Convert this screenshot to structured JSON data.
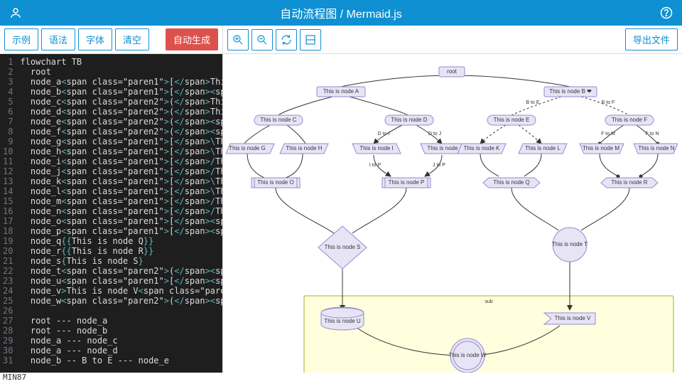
{
  "header": {
    "title": "自动流程图 / Mermaid.js"
  },
  "toolbar_left": {
    "example": "示例",
    "syntax": "语法",
    "font": "字体",
    "clear": "清空",
    "generate": "自动生成"
  },
  "toolbar_right": {
    "export": "导出文件"
  },
  "editor_lines": [
    {
      "n": 1,
      "raw": "flowchart TB"
    },
    {
      "n": 2,
      "raw": "  root"
    },
    {
      "n": 3,
      "raw": "  node_a[This is node A]"
    },
    {
      "n": 4,
      "raw": "  node_b[\"This is node B ❤ \"]",
      "str": true
    },
    {
      "n": 5,
      "raw": "  node_c(This is node C)"
    },
    {
      "n": 6,
      "raw": "  node_d(This is node D)"
    },
    {
      "n": 7,
      "raw": "  node_e([This is node E])"
    },
    {
      "n": 8,
      "raw": "  node_f([This is node F])"
    },
    {
      "n": 9,
      "raw": "  node_g[\\This is node G/]"
    },
    {
      "n": 10,
      "raw": "  node_h[\\This is node H/]"
    },
    {
      "n": 11,
      "raw": "  node_i[/This is node I/]"
    },
    {
      "n": 12,
      "raw": "  node_j[/This is node J/]"
    },
    {
      "n": 13,
      "raw": "  node_k[\\This is node K\\]"
    },
    {
      "n": 14,
      "raw": "  node_l[\\This is node L\\]"
    },
    {
      "n": 15,
      "raw": "  node_m[/This is node M\\]"
    },
    {
      "n": 16,
      "raw": "  node_n[/This is node N\\]"
    },
    {
      "n": 17,
      "raw": "  node_o[[This is node O]]"
    },
    {
      "n": 18,
      "raw": "  node_p[[This is node P]]"
    },
    {
      "n": 19,
      "raw": "  node_q{{This is node Q}}"
    },
    {
      "n": 20,
      "raw": "  node_r{{This is node R}}"
    },
    {
      "n": 21,
      "raw": "  node_s{This is node S}"
    },
    {
      "n": 22,
      "raw": "  node_t((This is node T))"
    },
    {
      "n": 23,
      "raw": "  node_u[(This is node U)]"
    },
    {
      "n": 24,
      "raw": "  node_v>This is node V]"
    },
    {
      "n": 25,
      "raw": "  node_w(((This is node W)))"
    },
    {
      "n": 26,
      "raw": ""
    },
    {
      "n": 27,
      "raw": "  root --- node_a"
    },
    {
      "n": 28,
      "raw": "  root --- node_b"
    },
    {
      "n": 29,
      "raw": "  node_a --- node_c"
    },
    {
      "n": 30,
      "raw": "  node_a --- node_d"
    },
    {
      "n": 31,
      "raw": "  node_b -- B to E --- node_e"
    }
  ],
  "diagram": {
    "root": "root",
    "sub_label": "sub",
    "labels": {
      "A": "This is node A",
      "B": "This is node B ❤",
      "C": "This is node C",
      "D": "This is node D",
      "E": "This is node E",
      "F": "This is node F",
      "G": "This is node G",
      "H": "This is node H",
      "I": "This is node I",
      "J": "This is node J",
      "K": "This is node K",
      "L": "This is node L",
      "M": "This is node M",
      "N": "This is node N",
      "O": "This is node O",
      "P": "This is node P",
      "Q": "This is node Q",
      "R": "This is node R",
      "S": "This is node S",
      "T": "This is node T",
      "U": "This is node U",
      "V": "This is node V",
      "W": "This is node W"
    },
    "edge_labels": {
      "be": "B to E",
      "bf": "B to F",
      "di": "D to I",
      "dj": "D to J",
      "fm": "F to M",
      "fn": "F to N",
      "ip": "I to P",
      "jp": "J to P"
    }
  },
  "footer": "MIN87"
}
